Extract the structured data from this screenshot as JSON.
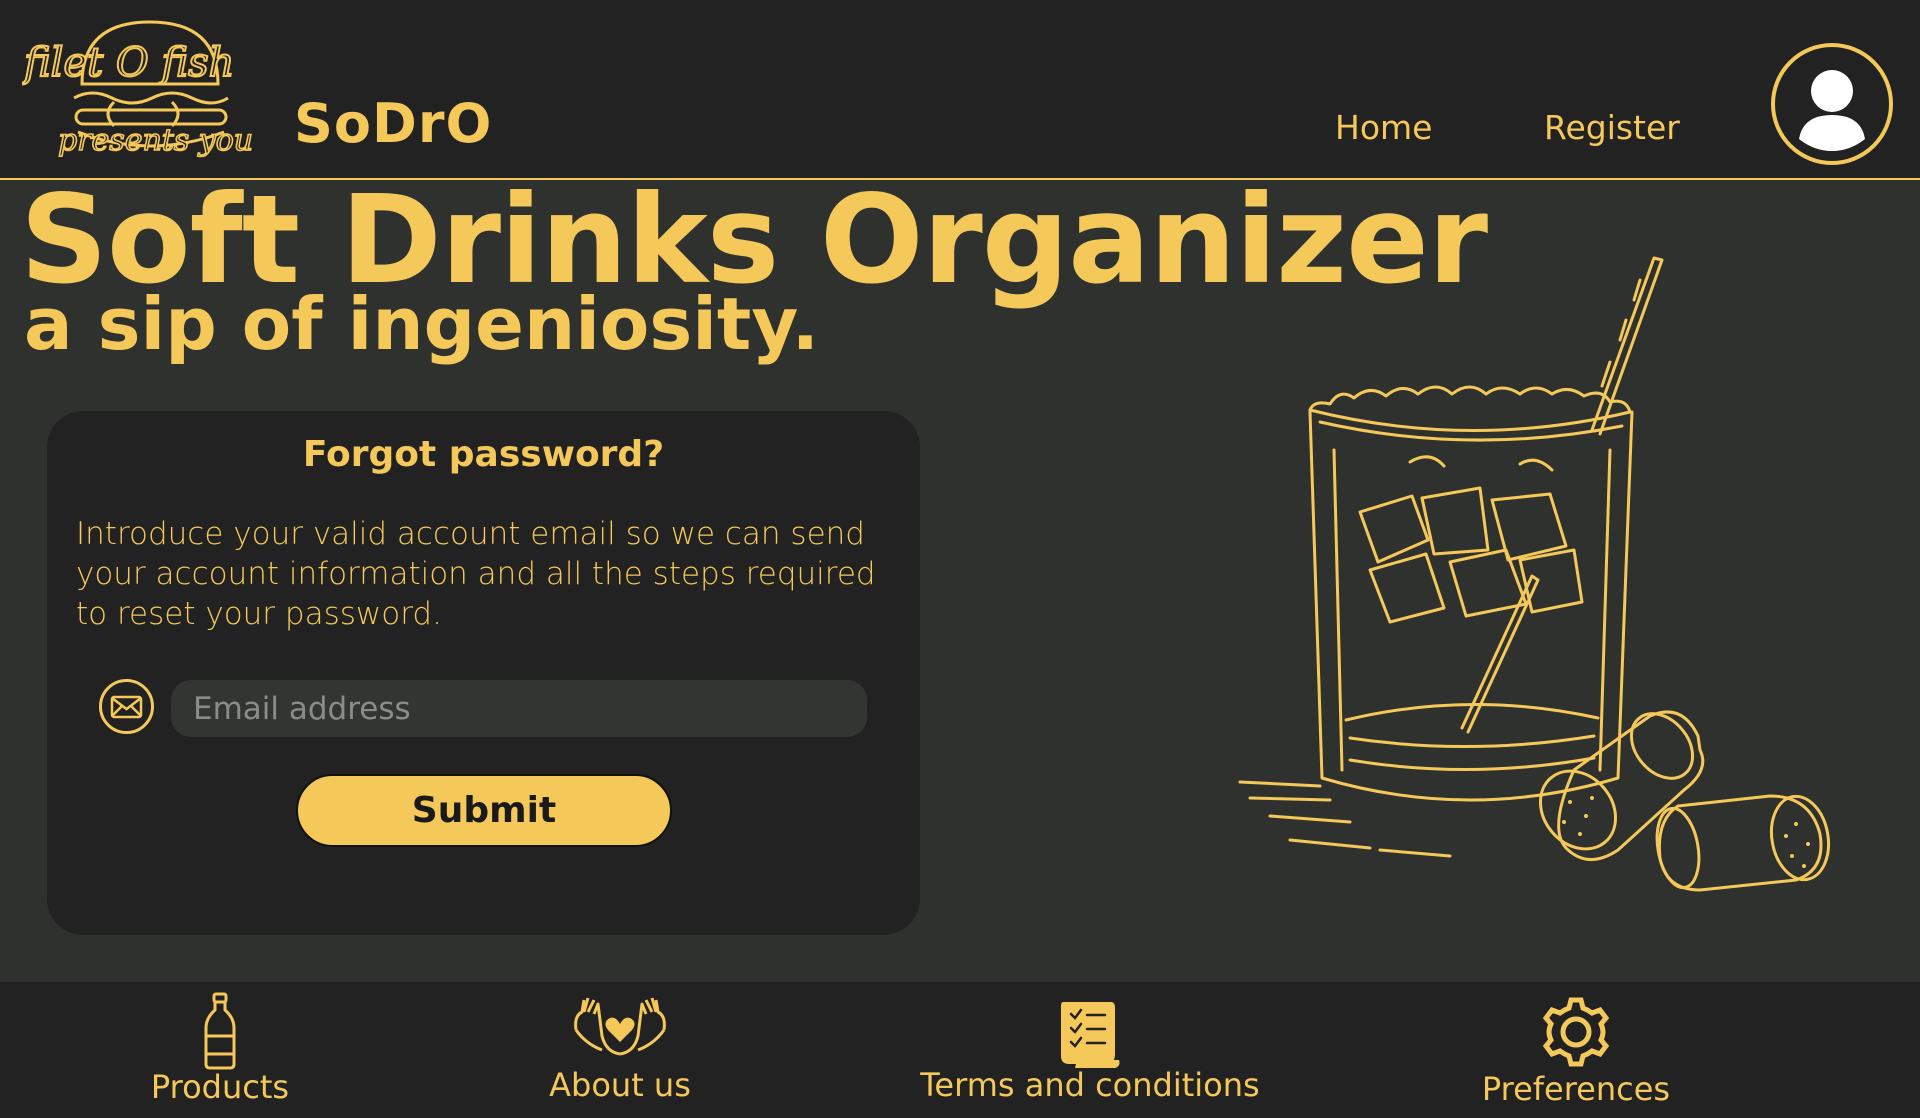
{
  "header": {
    "logo_text_top": "filet O fish",
    "logo_text_bottom": "presents you",
    "brand": "SoDrO",
    "nav": [
      {
        "label": "Home"
      },
      {
        "label": "Register"
      }
    ],
    "profile_icon": "user-avatar-icon"
  },
  "hero": {
    "title": "Soft Drinks Organizer",
    "subtitle": "a sip of ingeniosity."
  },
  "card": {
    "title": "Forgot password?",
    "description": "Introduce your valid account email so we can send your account information and all the steps required to reset your password.",
    "email_icon": "envelope-icon",
    "email_placeholder": "Email address",
    "email_value": "",
    "submit_label": "Submit"
  },
  "illustration_icon": "cocktail-glass-with-corks-illustration",
  "footer": {
    "items": [
      {
        "label": "Products",
        "icon": "bottle-icon"
      },
      {
        "label": "About us",
        "icon": "hands-heart-icon"
      },
      {
        "label": "Terms and conditions",
        "icon": "scroll-checklist-icon"
      },
      {
        "label": "Preferences",
        "icon": "gear-icon"
      }
    ]
  },
  "colors": {
    "accent": "#f5c85a",
    "header_bg": "#222222",
    "page_bg": "#2f312f",
    "input_bg": "#333533"
  }
}
